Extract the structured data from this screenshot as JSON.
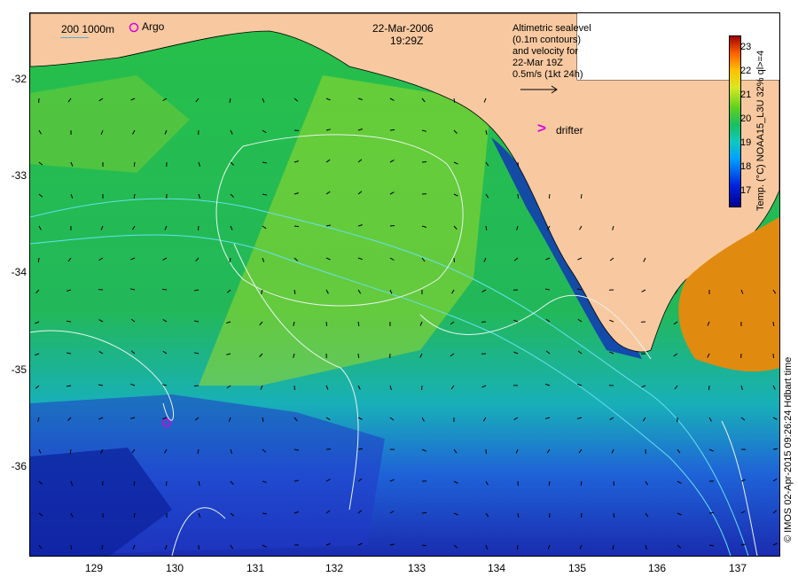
{
  "map": {
    "date": "22-Mar-2006",
    "time": "19:29Z",
    "bathy_legend": "200 1000m",
    "argo_label": "Argo",
    "drifter_symbol": ">",
    "drifter_label": "drifter",
    "annotation_lines": [
      "Altimetric sealevel",
      "(0.1m contours)",
      "and velocity for",
      "22-Mar 19Z",
      "0.5m/s (1kt 24h)"
    ],
    "y_ticks": [
      "-32",
      "-33",
      "-34",
      "-35",
      "-36"
    ],
    "x_ticks": [
      "129",
      "130",
      "131",
      "132",
      "133",
      "134",
      "135",
      "136",
      "137"
    ],
    "colorbar": {
      "ticks": [
        "23",
        "22",
        "21",
        "20",
        "19",
        "18",
        "17"
      ],
      "title": "Temp. (°C) NOAA15_L3U 32% ql>=4"
    },
    "credit": "© IMOS 02-Apr-2015 09:26:24 Hdbart time",
    "colors": {
      "land": "#f8c9a0",
      "sea_green": "#22bb55",
      "sea_cyan": "#18b8c0",
      "sea_blue": "#1a3acc",
      "warm_gulf": "#e08a10",
      "argo_marker": "#dd00dd"
    }
  }
}
